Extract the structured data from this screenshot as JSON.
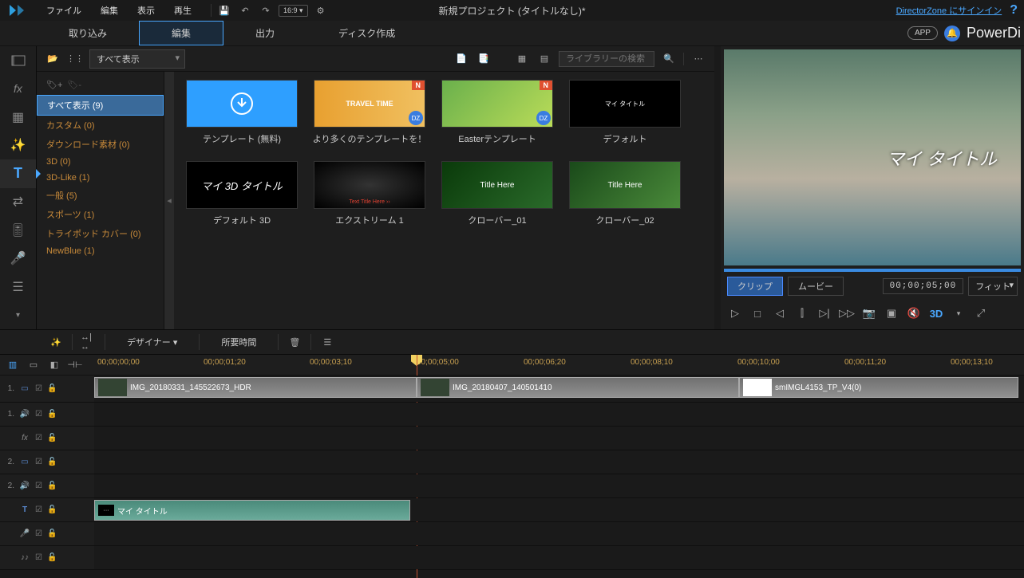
{
  "menu": {
    "file": "ファイル",
    "edit": "編集",
    "view": "表示",
    "play": "再生"
  },
  "aspect": "16:9",
  "project_title": "新規プロジェクト (タイトルなし)*",
  "signin_link": "DirectorZone にサインイン",
  "app_badge": "APP",
  "brand": "PowerDi",
  "tabs": {
    "import": "取り込み",
    "edit": "編集",
    "output": "出力",
    "disc": "ディスク作成"
  },
  "lib_filter": "すべて表示",
  "search_placeholder": "ライブラリーの検索",
  "tree": [
    {
      "label": "すべて表示  (9)",
      "selected": true
    },
    {
      "label": "カスタム  (0)"
    },
    {
      "label": "ダウンロード素材  (0)"
    },
    {
      "label": "3D  (0)"
    },
    {
      "label": "3D-Like  (1)"
    },
    {
      "label": "一般  (5)"
    },
    {
      "label": "スポーツ  (1)"
    },
    {
      "label": "トライポッド カバー  (0)"
    },
    {
      "label": "NewBlue  (1)"
    }
  ],
  "templates": [
    {
      "label": "テンプレート (無料)",
      "style": "blue",
      "icon": "download"
    },
    {
      "label": "より多くのテンプレートを！",
      "style": "travel",
      "n": true,
      "dz": true,
      "text": "TRAVEL TIME"
    },
    {
      "label": "Easterテンプレート",
      "style": "easter",
      "n": true,
      "dz": true
    },
    {
      "label": "デフォルト",
      "style": "black",
      "text": "マイ タイトル"
    },
    {
      "label": "デフォルト 3D",
      "style": "black",
      "text": "マイ 3D タイトル"
    },
    {
      "label": "エクストリーム 1",
      "style": "dark",
      "text": "Text Title Here ››"
    },
    {
      "label": "クローバー_01",
      "style": "green1",
      "text": "Title Here"
    },
    {
      "label": "クローバー_02",
      "style": "green2",
      "text": "Title Here"
    }
  ],
  "preview_text": "マイ タイトル",
  "preview": {
    "clip": "クリップ",
    "movie": "ムービー",
    "timecode": "00;00;05;00",
    "fit": "フィット"
  },
  "mid": {
    "designer": "デザイナー",
    "duration": "所要時間"
  },
  "ruler": [
    "00;00;00;00",
    "00;00;01;20",
    "00;00;03;10",
    "00;00;05;00",
    "00;00;06;20",
    "00;00;08;10",
    "00;00;10;00",
    "00;00;11;20",
    "00;00;13;10"
  ],
  "clips": {
    "v1a": "IMG_20180331_145522673_HDR",
    "v1b": "IMG_20180407_140501410",
    "v1c": "smIMGL4153_TP_V4(0)",
    "title": "マイ タイトル"
  },
  "track_labels": {
    "t1": "1.",
    "t2": "1.",
    "t3": "fx",
    "t4": "2.",
    "t5": "2.",
    "t6": "T",
    "t7": "♪♪"
  },
  "dz_text": "DZ"
}
